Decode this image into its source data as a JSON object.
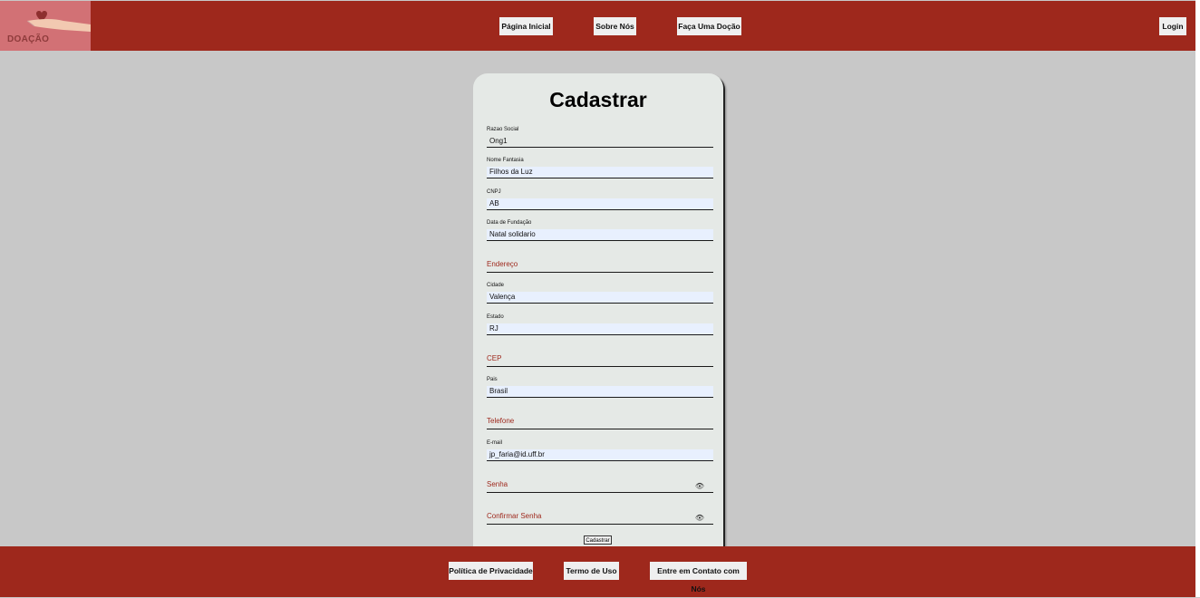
{
  "header": {
    "logo_text": "DOAÇÃO",
    "nav": [
      "Página Inicial",
      "Sobre Nós",
      "Faça Uma Doção"
    ],
    "login_label": "Login"
  },
  "form": {
    "title": "Cadastrar",
    "fields": [
      {
        "label": "Razao Social",
        "value": "Ong1"
      },
      {
        "label": "Nome Fantasia",
        "value": "Filhos da Luz"
      },
      {
        "label": "CNPJ",
        "value": "AB"
      },
      {
        "label": "Data de Fundação",
        "value": "Natal solidario"
      },
      {
        "placeholder": "Endereço"
      },
      {
        "label": "Cidade",
        "value": "Valença"
      },
      {
        "label": "Estado",
        "value": "RJ"
      },
      {
        "placeholder": "CEP"
      },
      {
        "label": "Pais",
        "value": "Brasil"
      },
      {
        "placeholder": "Telefone"
      },
      {
        "label": "E-mail",
        "value": "jp_faria@id.uff.br"
      },
      {
        "placeholder": "Senha",
        "icon": "eye-icon"
      },
      {
        "placeholder": "Confirmar Senha",
        "icon": "eye-icon"
      }
    ],
    "submit_label": "Cadastrar"
  },
  "footer": {
    "links": [
      "Política de Privacidade",
      "Termo de Uso",
      "Entre em Contato com Nós"
    ]
  },
  "colors": {
    "brand_red": "#9e281c",
    "background": "#c8c8c8",
    "card": "#e5e9e6",
    "autofill": "#e8f0fe",
    "logo_bg": "#d27175"
  }
}
